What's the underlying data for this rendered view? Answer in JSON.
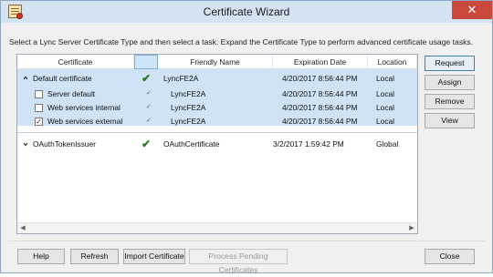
{
  "window": {
    "title": "Certificate Wizard",
    "close_glyph": "✕"
  },
  "instructions": "Select a Lync Server Certificate Type and then select a task. Expand the Certificate Type to perform advanced certificate usage tasks.",
  "columns": [
    "Certificate",
    "",
    "Friendly Name",
    "Expiration Date",
    "Location"
  ],
  "rows": [
    {
      "type": "group",
      "expanded": true,
      "name": "Default certificate",
      "status": "✔",
      "friendly": "LyncFE2A",
      "expires": "4/20/2017 8:56:44 PM",
      "location": "Local"
    },
    {
      "type": "child",
      "checked": false,
      "name": "Server default",
      "status": "✓",
      "friendly": "LyncFE2A",
      "expires": "4/20/2017 8:56:44 PM",
      "location": "Local"
    },
    {
      "type": "child",
      "checked": false,
      "name": "Web services internal",
      "status": "✓",
      "friendly": "LyncFE2A",
      "expires": "4/20/2017 8:56:44 PM",
      "location": "Local"
    },
    {
      "type": "child",
      "checked": true,
      "name": "Web services external",
      "status": "✓",
      "friendly": "LyncFE2A",
      "expires": "4/20/2017 8:56:44 PM",
      "location": "Local"
    },
    {
      "type": "group",
      "expanded": false,
      "name": "OAuthTokenIssuer",
      "status": "✔",
      "friendly": "OAuthCertificate",
      "expires": "3/2/2017 1:59:42 PM",
      "location": "Global"
    }
  ],
  "side_buttons": [
    "Request",
    "Assign",
    "Remove",
    "View"
  ],
  "bottom_buttons": {
    "help": "Help",
    "refresh": "Refresh",
    "import": "Import Certificate",
    "process": "Process Pending Certificates",
    "close": "Close"
  },
  "colors": {
    "selection": "#cfe2f6",
    "check_green": "#2b7a1d",
    "title_bar": "#d4e3f2",
    "close_red": "#c94a3d"
  }
}
